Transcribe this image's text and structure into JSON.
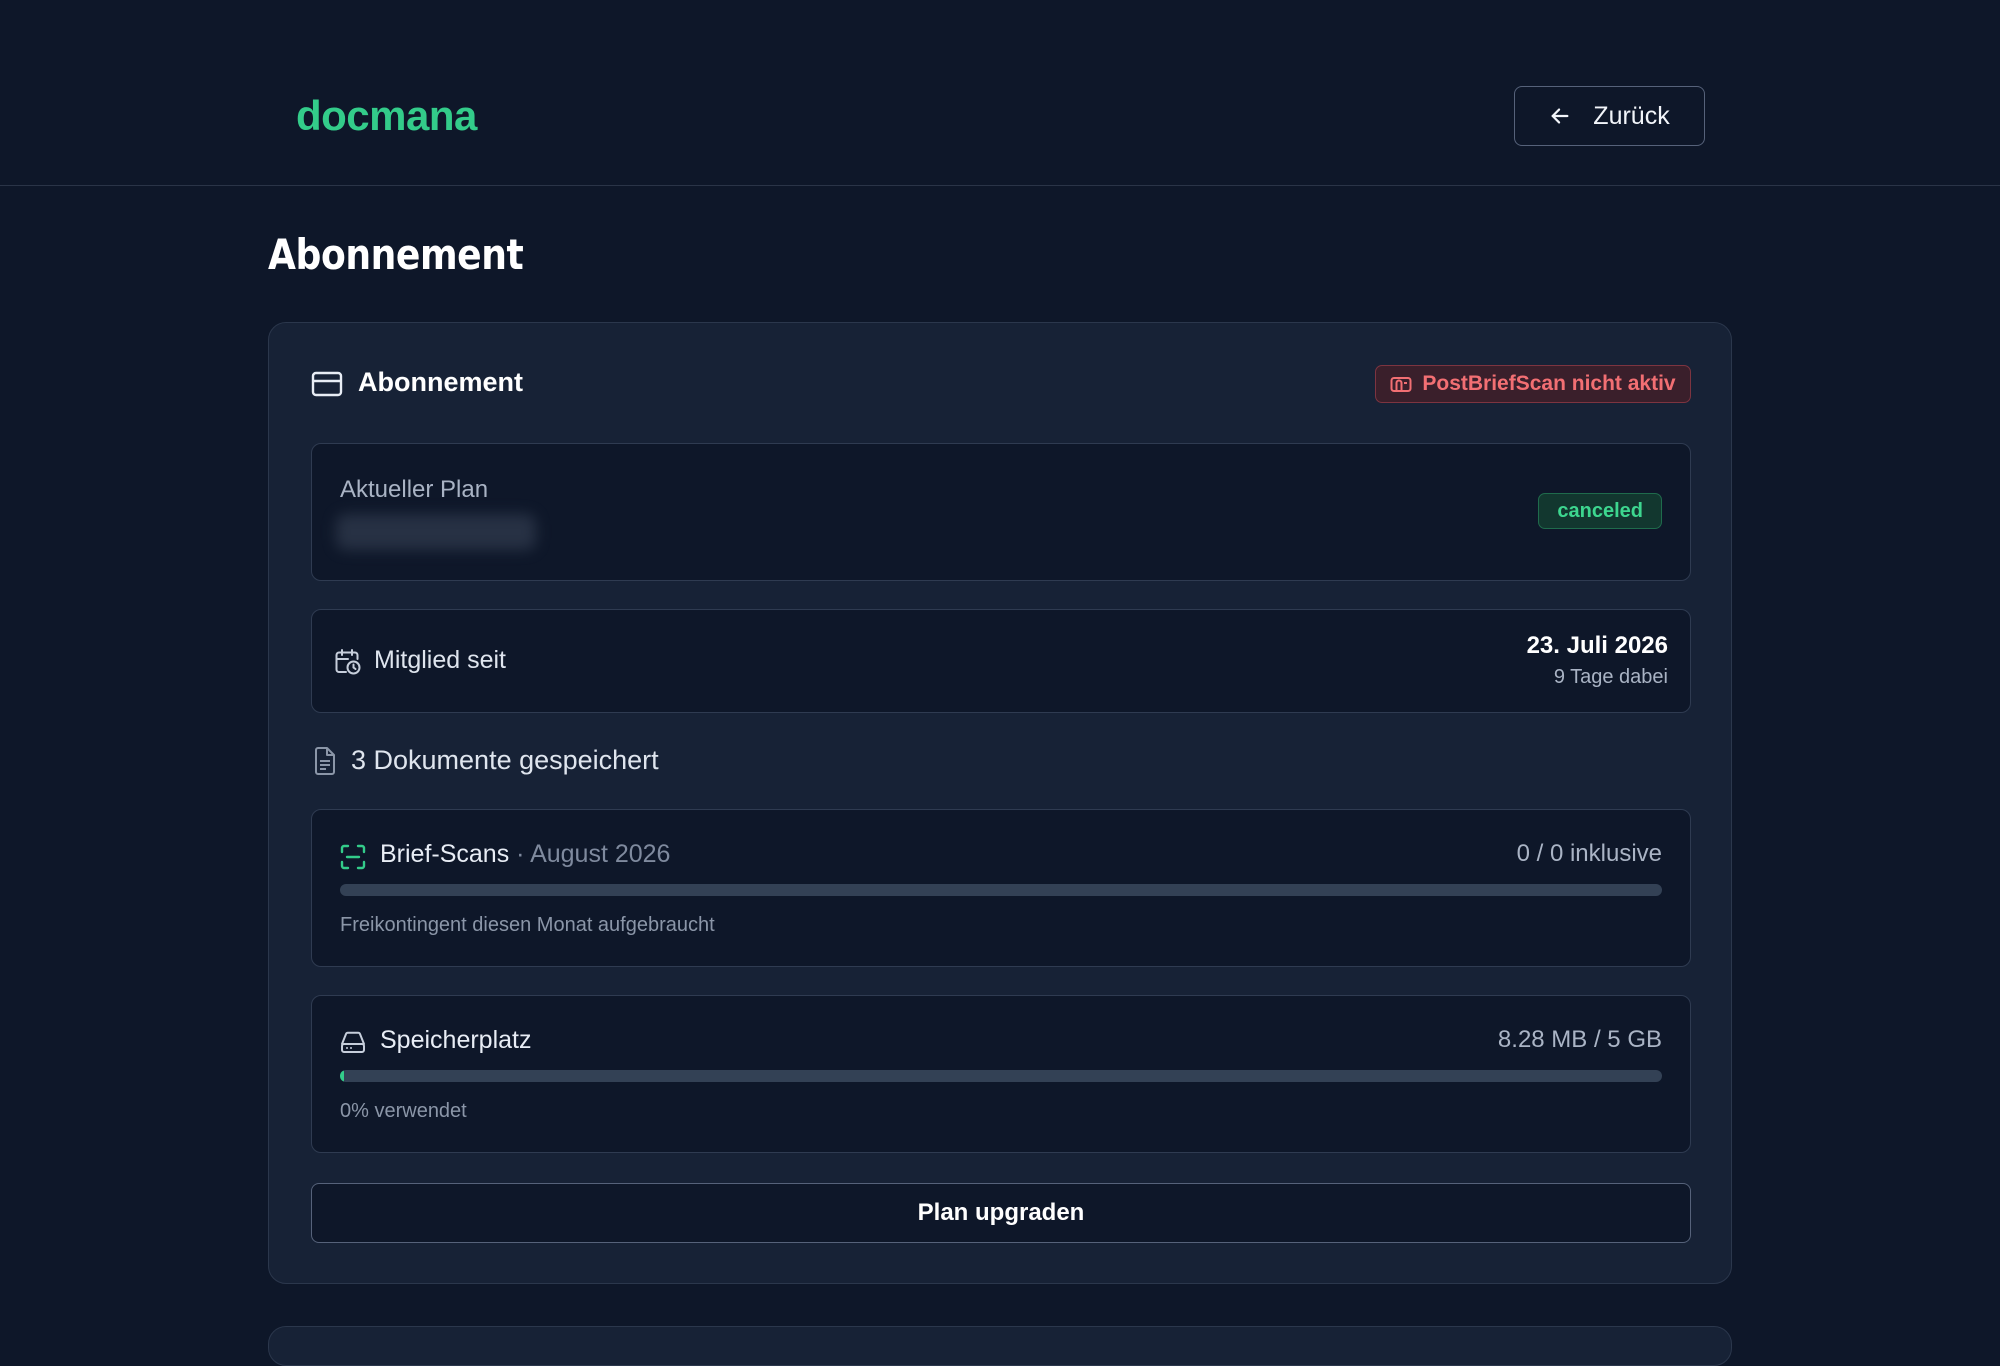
{
  "header": {
    "logo": "docmana",
    "back_label": "Zurück",
    "back_icon": "arrow-left-icon"
  },
  "page_title": "Abonnement",
  "card": {
    "title": "Abonnement",
    "title_icon": "credit-card-icon",
    "warning_badge": "PostBriefScan nicht aktiv",
    "warning_icon": "mailbox-icon",
    "plan": {
      "label": "Aktueller Plan",
      "status": "canceled"
    },
    "member": {
      "label": "Mitglied seit",
      "date": "23. Juli 2026",
      "days": "9 Tage dabei"
    },
    "documents": {
      "text": "3 Dokumente gespeichert"
    },
    "scans": {
      "title": "Brief-Scans",
      "period": "· August 2026",
      "value": "0 / 0 inklusive",
      "note": "Freikontingent diesen Monat aufgebraucht",
      "fill_fraction": 0.0
    },
    "storage": {
      "title": "Speicherplatz",
      "value": "8.28 MB / 5 GB",
      "note": "0% verwendet",
      "fill_fraction": 0.002
    },
    "upgrade_label": "Plan upgraden"
  },
  "colors": {
    "background": "#0e1729",
    "card": "#172236",
    "accent": "#33cc8a",
    "danger": "#f26f73"
  }
}
